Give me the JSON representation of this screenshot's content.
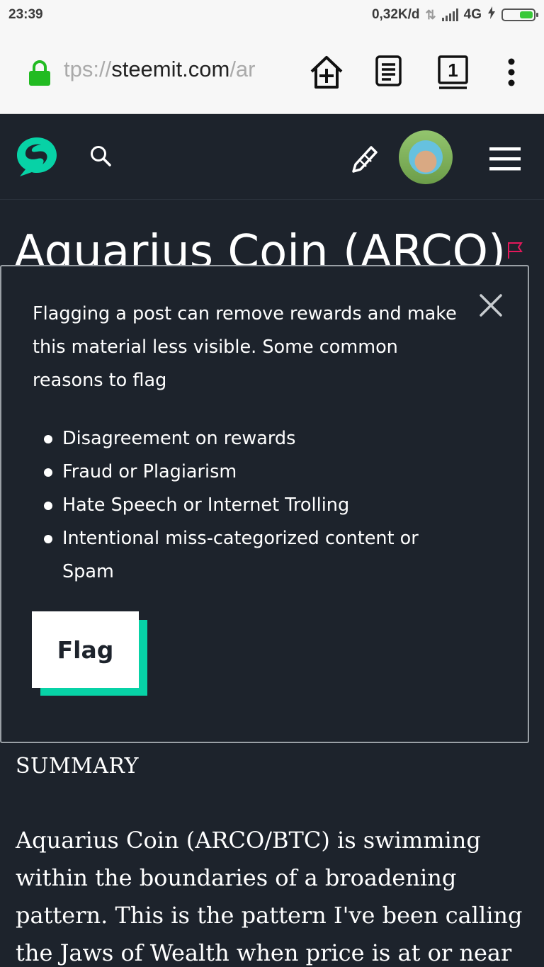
{
  "status_bar": {
    "time": "23:39",
    "network_speed": "0,32K/d",
    "network_type": "4G",
    "battery_color": "#37c837"
  },
  "browser": {
    "url_prefix": "tps://",
    "url_host": "steemit.com",
    "url_suffix": "/ar",
    "tab_count": "1",
    "icons": [
      "lock-icon",
      "add-to-home-icon",
      "reader-mode-icon",
      "tabs-icon",
      "more-options-icon"
    ]
  },
  "app_header": {
    "icons": [
      "steemit-logo",
      "search-icon",
      "pencil-icon",
      "user-avatar",
      "hamburger-menu-icon"
    ],
    "accent_color": "#07d2a6"
  },
  "post": {
    "title": "Aquarius Coin (ARCO)",
    "section_heading": "SUMMARY",
    "body": "Aquarius Coin (ARCO/BTC) is swimming within the boundaries of a broadening pattern. This is the pattern I've been calling the Jaws of Wealth when price is at or near"
  },
  "flag_modal": {
    "intro": "Flagging a post can remove rewards and make this material less visible. Some common reasons to flag",
    "reasons": [
      "Disagreement on rewards",
      "Fraud or Plagiarism",
      "Hate Speech or Internet Trolling",
      "Intentional miss-categorized content or Spam"
    ],
    "flag_button_label": "Flag"
  }
}
